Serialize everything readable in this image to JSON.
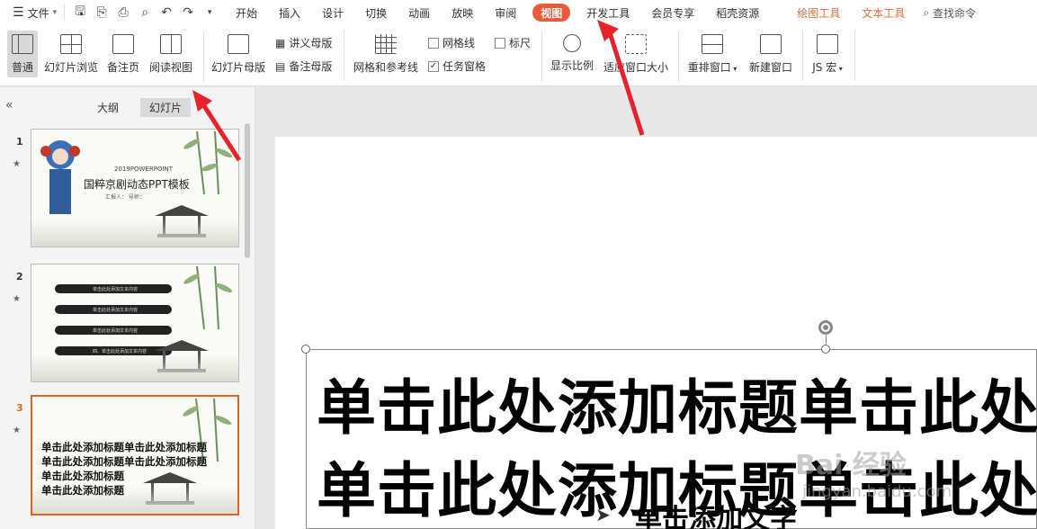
{
  "menubar": {
    "file_label": "文件",
    "tabs": [
      {
        "label": "开始"
      },
      {
        "label": "插入"
      },
      {
        "label": "设计"
      },
      {
        "label": "切换"
      },
      {
        "label": "动画"
      },
      {
        "label": "放映"
      },
      {
        "label": "审阅"
      },
      {
        "label": "视图",
        "active": true
      },
      {
        "label": "开发工具"
      },
      {
        "label": "会员专享"
      },
      {
        "label": "稻壳资源"
      },
      {
        "label": "绘图工具"
      },
      {
        "label": "文本工具"
      }
    ],
    "search_label": "查找命令",
    "accent_color": "#e95c3a"
  },
  "ribbon": {
    "normal": "普通",
    "slide_sorter": "幻灯片浏览",
    "notes_page": "备注页",
    "reading_view": "阅读视图",
    "slide_master": "幻灯片母版",
    "handout_master": "讲义母版",
    "notes_master": "备注母版",
    "grid_guides": "网格和参考线",
    "gridlines": "网格线",
    "ruler": "标尺",
    "task_pane": "任务窗格",
    "zoom": "显示比例",
    "fit_window": "适应窗口大小",
    "arrange": "重排窗口",
    "new_window": "新建窗口",
    "js_macro": "JS 宏"
  },
  "leftpanel": {
    "tab_outline": "大纲",
    "tab_slides": "幻灯片",
    "slides": [
      {
        "num": "1",
        "year": "2019POWERPOINT",
        "title": "国粹京剧动态PPT模板",
        "byline": "汇报人：    导师："
      },
      {
        "num": "2",
        "items": [
          "单击此处添加文本内容",
          "单击此处添加文本内容",
          "单击此处添加文本内容",
          "四、单击此处添加文本内容"
        ]
      },
      {
        "num": "3",
        "active": true,
        "lines": [
          "单击此处添加标题单击此处添加标题",
          "单击此处添加标题单击此处添加标题",
          "单击此处添加标题",
          "单击此处添加标题"
        ]
      }
    ]
  },
  "canvas": {
    "title_line1": "单击此处添加标题单击此处添",
    "title_line2": "单击此处添加标题单击此处添",
    "subtext": "单击添加文字"
  },
  "watermark": {
    "brand": "Bai 经验",
    "url": "jingyan.baidu.com"
  }
}
